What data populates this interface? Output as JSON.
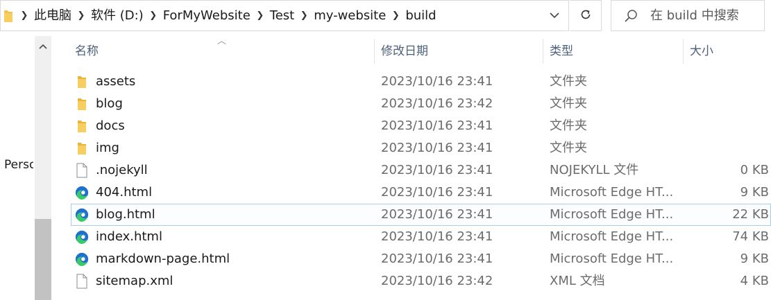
{
  "address": {
    "crumbs": [
      "此电脑",
      "软件 (D:)",
      "ForMyWebsite",
      "Test",
      "my-website",
      "build"
    ]
  },
  "search": {
    "placeholder": "在 build 中搜索"
  },
  "nav": {
    "partial_item": "Perso"
  },
  "columns": {
    "name": "名称",
    "date": "修改日期",
    "type": "类型",
    "size": "大小"
  },
  "files": [
    {
      "name": "assets",
      "date": "2023/10/16 23:41",
      "type": "文件夹",
      "size": "",
      "icon": "folder-icon"
    },
    {
      "name": "blog",
      "date": "2023/10/16 23:42",
      "type": "文件夹",
      "size": "",
      "icon": "folder-icon"
    },
    {
      "name": "docs",
      "date": "2023/10/16 23:41",
      "type": "文件夹",
      "size": "",
      "icon": "folder-icon"
    },
    {
      "name": "img",
      "date": "2023/10/16 23:41",
      "type": "文件夹",
      "size": "",
      "icon": "folder-icon"
    },
    {
      "name": ".nojekyll",
      "date": "2023/10/16 23:41",
      "type": "NOJEKYLL 文件",
      "size": "0 KB",
      "icon": "file-icon"
    },
    {
      "name": "404.html",
      "date": "2023/10/16 23:41",
      "type": "Microsoft Edge HT...",
      "size": "9 KB",
      "icon": "edge-icon"
    },
    {
      "name": "blog.html",
      "date": "2023/10/16 23:41",
      "type": "Microsoft Edge HT...",
      "size": "22 KB",
      "icon": "edge-icon",
      "selected": true
    },
    {
      "name": "index.html",
      "date": "2023/10/16 23:41",
      "type": "Microsoft Edge HT...",
      "size": "74 KB",
      "icon": "edge-icon"
    },
    {
      "name": "markdown-page.html",
      "date": "2023/10/16 23:41",
      "type": "Microsoft Edge HT...",
      "size": "9 KB",
      "icon": "edge-icon"
    },
    {
      "name": "sitemap.xml",
      "date": "2023/10/16 23:42",
      "type": "XML 文档",
      "size": "4 KB",
      "icon": "file-icon"
    }
  ],
  "colors": {
    "folder": "#f2c14e",
    "edge_blue": "#1d6fd1",
    "edge_green": "#3bc96a",
    "selection": "#a8cce8"
  }
}
